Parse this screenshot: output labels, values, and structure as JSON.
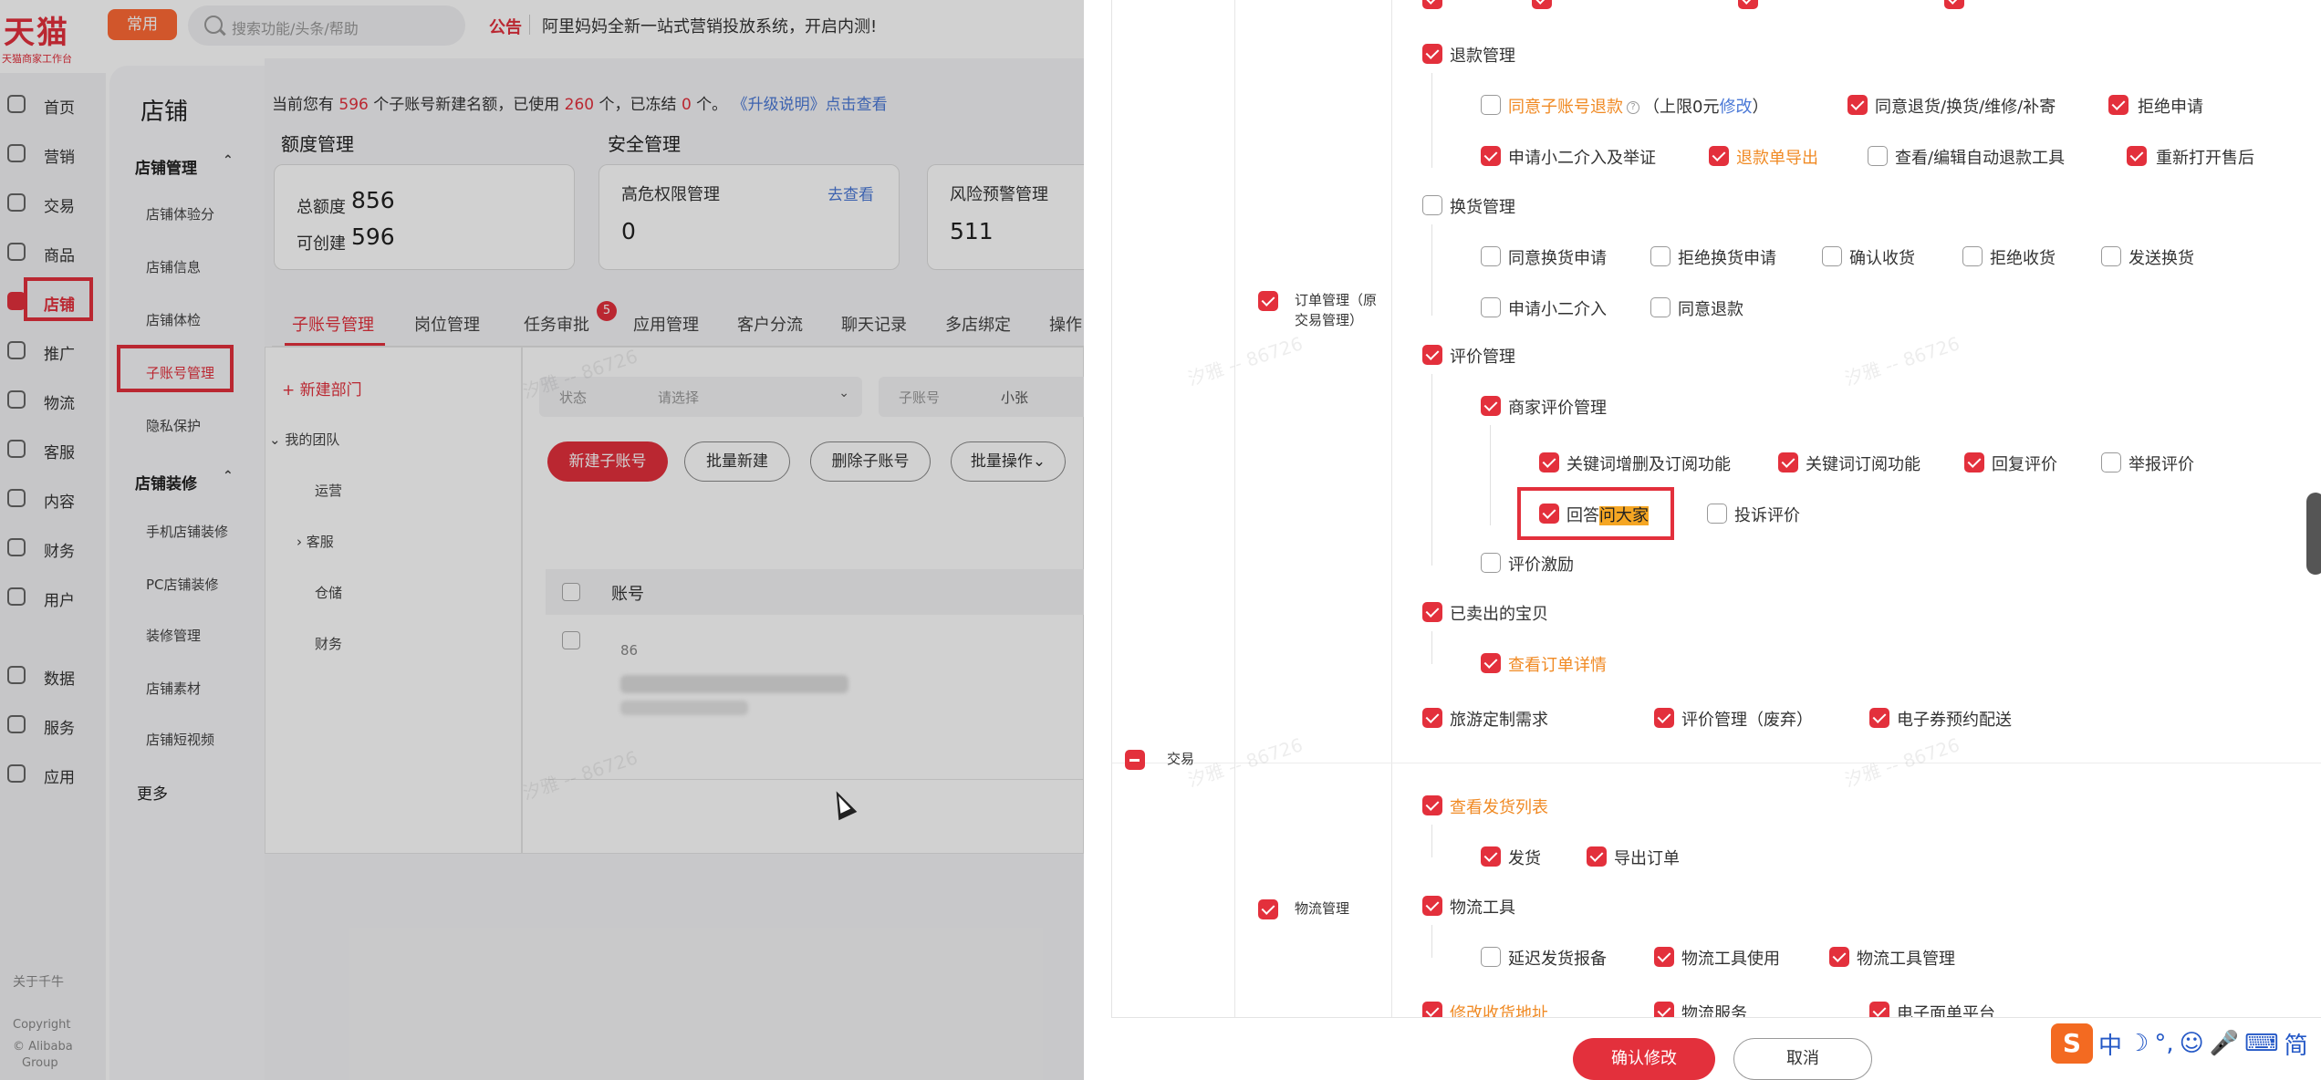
{
  "app": {
    "logo": "天猫",
    "logo_sub": "天猫商家工作台",
    "common_btn": "常用",
    "search_placeholder": "搜索功能/头条/帮助",
    "notice_tag": "公告",
    "notice_text": "阿里妈妈全新一站式营销投放系统，开启内测!"
  },
  "leftnav": {
    "items": [
      "首页",
      "营销",
      "交易",
      "商品",
      "店铺",
      "推广",
      "物流",
      "客服",
      "内容",
      "财务",
      "用户",
      "数据",
      "服务",
      "应用"
    ],
    "active": "店铺",
    "footer": [
      "关于千牛",
      "Copyright",
      "© Alibaba",
      "Group"
    ]
  },
  "subnav": {
    "title": "店铺",
    "group1": "店铺管理",
    "group1_items": [
      "店铺体验分",
      "店铺信息",
      "店铺体检",
      "子账号管理",
      "隐私保护"
    ],
    "group2": "店铺装修",
    "group2_items": [
      "手机店铺装修",
      "PC店铺装修",
      "装修管理",
      "店铺素材",
      "店铺短视频"
    ],
    "more": "更多"
  },
  "main": {
    "quota": {
      "prefix": "当前您有",
      "count": "596",
      "mid1": "个子账号新建名额，已使用",
      "used": "260",
      "mid2": "个，已冻结",
      "frozen": "0",
      "mid3": "个。",
      "link": "《升级说明》点击查看"
    },
    "section_quota": "额度管理",
    "section_security": "安全管理",
    "card_total_label": "总额度",
    "card_total_value": "856",
    "card_creatable_label": "可创建",
    "card_creatable_value": "596",
    "card_highrisk_label": "高危权限管理",
    "card_highrisk_value": "0",
    "card_highrisk_link": "去查看",
    "card_risk_label": "风险预警管理",
    "card_risk_value": "511",
    "tabs": [
      "子账号管理",
      "岗位管理",
      "任务审批",
      "应用管理",
      "客户分流",
      "聊天记录",
      "多店绑定",
      "操作"
    ],
    "task_badge": "5",
    "new_dept": "+ 新建部门",
    "team": "我的团队",
    "depts": [
      "运营",
      "客服",
      "仓储",
      "财务"
    ],
    "filter_status_label": "状态",
    "filter_status_value": "请选择",
    "filter_sub_label": "子账号",
    "filter_sub_value": "小张",
    "btn_new": "新建子账号",
    "btn_batch_new": "批量新建",
    "btn_delete": "删除子账号",
    "btn_batch_ops": "批量操作",
    "col_account": "账号",
    "row_partial": "86",
    "watermark": "汐雅 -- 86726"
  },
  "drawer": {
    "cat_order": "订单管理（原交易管理）",
    "cat_trade": "交易",
    "cat_logistics": "物流管理",
    "refund_mgmt": "退款管理",
    "refund_sub_account": "同意子账号退款",
    "refund_limit_pre": "（上限0元",
    "refund_limit_edit": "修改",
    "refund_limit_post": "）",
    "refund_agree": "同意退货/换货/维修/补寄",
    "refund_reject": "拒绝申请",
    "refund_intervene": "申请小二介入及举证",
    "refund_export": "退款单导出",
    "refund_auto_tool": "查看/编辑自动退款工具",
    "refund_reopen": "重新打开售后",
    "exchange_mgmt": "换货管理",
    "exchange_agree": "同意换货申请",
    "exchange_reject": "拒绝换货申请",
    "exchange_confirm": "确认收货",
    "exchange_reject_recv": "拒绝收货",
    "exchange_send": "发送换货",
    "exchange_intervene": "申请小二介入",
    "exchange_refund": "同意退款",
    "review_mgmt": "评价管理",
    "merchant_review": "商家评价管理",
    "keyword_delete": "关键词增删及订阅功能",
    "keyword_subscribe": "关键词订阅功能",
    "reply_review": "回复评价",
    "report_review": "举报评价",
    "answer_pre": "回答",
    "answer_hl": "问大家",
    "complain_review": "投诉评价",
    "review_incentive": "评价激励",
    "sold_items": "已卖出的宝贝",
    "view_order_detail": "查看订单详情",
    "travel": "旅游定制需求",
    "review_deprecated": "评价管理（废弃）",
    "eticket": "电子券预约配送",
    "ship_list": "查看发货列表",
    "ship": "发货",
    "export_order": "导出订单",
    "logistics_tools": "物流工具",
    "delay_ship": "延迟发货报备",
    "logistics_tool_use": "物流工具使用",
    "logistics_tool_mgmt": "物流工具管理",
    "modify_address": "修改收货地址",
    "logistics_service": "物流服务",
    "e_waybill": "电子面单平台",
    "confirm": "确认修改",
    "cancel": "取消",
    "ime_logo": "S",
    "ime_glyphs": [
      "中",
      "☽",
      "°,",
      "☺",
      "🎤",
      "⌨",
      "简"
    ]
  },
  "colors": {
    "accent": "#e3303c",
    "highlight": "#f08a24",
    "link": "#4a78d6"
  }
}
